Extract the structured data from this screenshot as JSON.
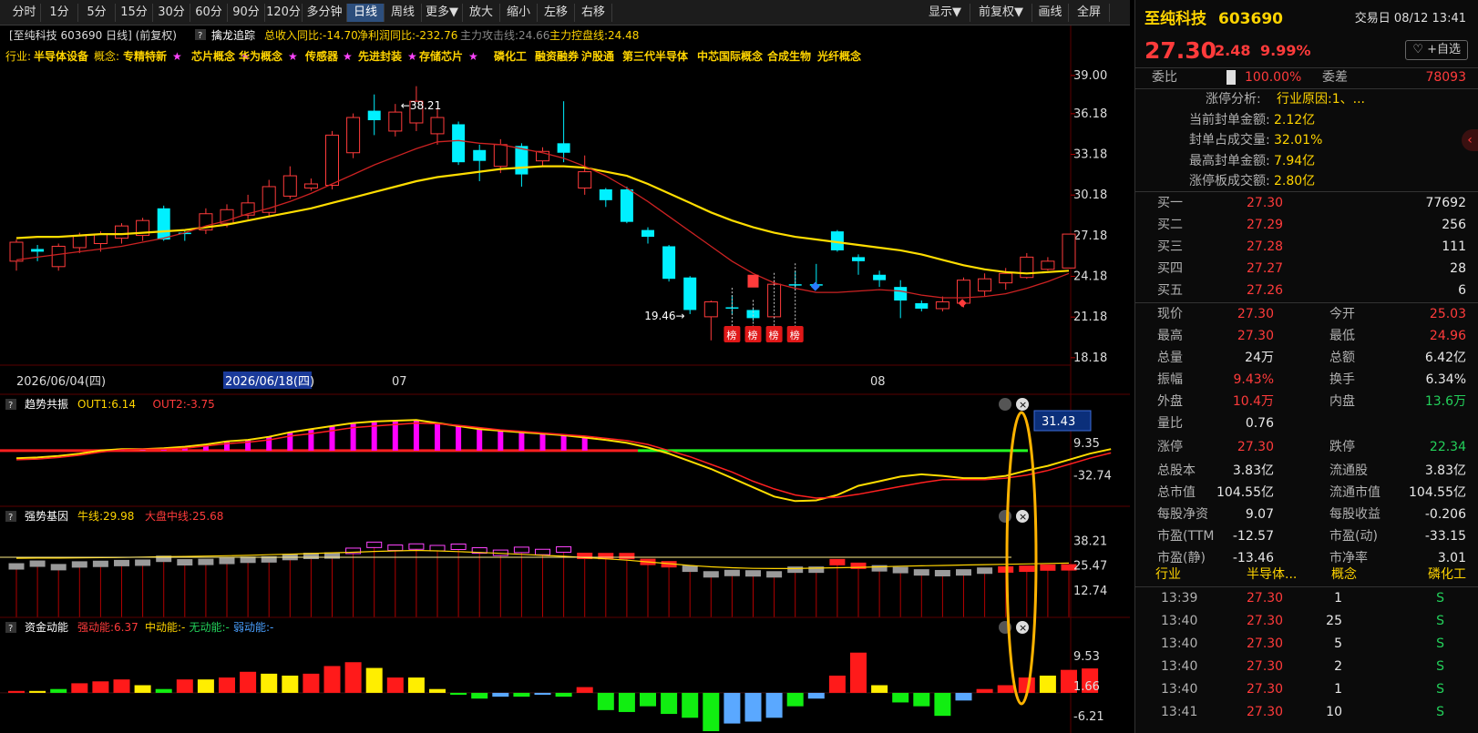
{
  "toolbar": {
    "buttons": [
      "分时",
      "1分",
      "5分",
      "15分",
      "30分",
      "60分",
      "90分",
      "120分",
      "多分钟",
      "日线",
      "周线",
      "更多▼",
      "放大",
      "缩小",
      "左移",
      "右移"
    ],
    "active_index": 9,
    "right_buttons": [
      "显示▼",
      "前复权▼",
      "画线",
      "全屏"
    ]
  },
  "chart_header": {
    "main": {
      "title": "[至纯科技 603690 日线] (前复权)",
      "indicator": "擒龙追踪",
      "rev": "总收入同比:-14.70",
      "profit": "净利润同比:-232.76",
      "attack": "主力攻击线:24.66",
      "control": "主力控盘线:24.48"
    },
    "industry_label": "行业:",
    "industry": "半导体设备",
    "concept_label": "概念:",
    "concepts": [
      "专精特新",
      "芯片概念",
      "华为概念",
      "传感器",
      "先进封装",
      "存储芯片",
      "磷化工",
      "融资融券",
      "沪股通",
      "第三代半导体",
      "中芯国际概念",
      "合成生物",
      "光纤概念"
    ],
    "concept_stars": [
      true,
      true,
      true,
      true,
      true,
      true,
      false,
      false,
      false,
      false,
      false,
      false,
      false
    ],
    "question_mark": "?"
  },
  "axis_dates": {
    "d1": "2026/06/04(四)",
    "d2": "2026/06/18(四)",
    "m1": "07",
    "m2": "08"
  },
  "chart_data": [
    {
      "type": "candlestick",
      "y_ticks": [
        39.0,
        36.18,
        33.18,
        30.18,
        27.18,
        24.18,
        21.18,
        18.18
      ],
      "y_tick_labels": [
        "39.00",
        "36.18",
        "33.18",
        "30.18",
        "27.18",
        "24.18",
        "21.18",
        "18.18"
      ],
      "ylim": [
        17.7,
        40.0
      ],
      "high_label": "38.21",
      "low_label": "19.46",
      "high_index": 18,
      "low_index": 32,
      "candles": [
        [
          25.3,
          26.7,
          24.6,
          26.9
        ],
        [
          26.2,
          26.0,
          25.3,
          26.5
        ],
        [
          24.9,
          26.4,
          24.6,
          26.6
        ],
        [
          26.3,
          27.2,
          25.9,
          27.4
        ],
        [
          26.6,
          27.3,
          26.0,
          27.5
        ],
        [
          27.0,
          27.9,
          26.6,
          28.1
        ],
        [
          27.2,
          28.3,
          26.8,
          28.5
        ],
        [
          29.2,
          26.9,
          26.8,
          29.4
        ],
        [
          27.4,
          27.3,
          26.8,
          27.6
        ],
        [
          27.6,
          28.8,
          27.3,
          29.2
        ],
        [
          28.1,
          29.1,
          27.8,
          29.5
        ],
        [
          28.7,
          29.6,
          28.4,
          30.2
        ],
        [
          28.9,
          30.8,
          28.6,
          31.3
        ],
        [
          30.1,
          31.6,
          29.9,
          32.3
        ],
        [
          30.7,
          31.0,
          30.5,
          31.4
        ],
        [
          30.9,
          34.6,
          30.6,
          34.9
        ],
        [
          33.3,
          35.9,
          32.9,
          36.2
        ],
        [
          36.4,
          35.7,
          34.6,
          37.6
        ],
        [
          34.9,
          36.3,
          34.5,
          36.9
        ],
        [
          35.5,
          37.1,
          34.9,
          38.21
        ],
        [
          34.7,
          35.9,
          33.9,
          36.6
        ],
        [
          35.4,
          32.6,
          32.4,
          35.6
        ],
        [
          33.5,
          32.7,
          31.2,
          33.9
        ],
        [
          32.3,
          33.9,
          31.8,
          34.3
        ],
        [
          33.8,
          31.7,
          30.8,
          34.0
        ],
        [
          32.7,
          33.4,
          32.3,
          33.7
        ],
        [
          34.0,
          33.3,
          32.6,
          37.1
        ],
        [
          30.7,
          31.9,
          30.2,
          33.1
        ],
        [
          30.6,
          29.8,
          29.3,
          30.7
        ],
        [
          30.6,
          28.2,
          28.1,
          30.8
        ],
        [
          27.6,
          27.1,
          26.6,
          27.8
        ],
        [
          26.4,
          24.0,
          23.8,
          26.5
        ],
        [
          24.1,
          21.7,
          21.4,
          24.2
        ],
        [
          21.2,
          22.3,
          19.46,
          22.4
        ],
        [
          21.9,
          21.8,
          21.4,
          22.8
        ],
        [
          21.7,
          21.1,
          20.9,
          21.9
        ],
        [
          21.2,
          23.6,
          21.1,
          23.9
        ],
        [
          23.6,
          23.5,
          23.2,
          24.6
        ],
        [
          23.6,
          23.5,
          23.4,
          25.1
        ],
        [
          27.5,
          26.1,
          26.0,
          27.6
        ],
        [
          25.6,
          25.3,
          24.3,
          25.8
        ],
        [
          24.3,
          23.9,
          23.4,
          24.6
        ],
        [
          23.4,
          22.4,
          21.1,
          23.9
        ],
        [
          22.2,
          21.8,
          21.6,
          22.4
        ],
        [
          21.8,
          22.3,
          21.6,
          22.7
        ],
        [
          22.2,
          23.9,
          21.9,
          24.1
        ],
        [
          23.1,
          24.0,
          22.7,
          24.4
        ],
        [
          23.7,
          24.4,
          23.2,
          24.8
        ],
        [
          24.1,
          25.6,
          24.0,
          25.9
        ],
        [
          24.7,
          25.3,
          24.6,
          25.6
        ],
        [
          24.8,
          27.3,
          24.8,
          27.3
        ]
      ],
      "ma_slow": [
        27.0,
        27.1,
        27.1,
        27.2,
        27.3,
        27.3,
        27.4,
        27.5,
        27.6,
        27.8,
        28.0,
        28.3,
        28.6,
        28.9,
        29.2,
        29.6,
        30.0,
        30.4,
        30.8,
        31.2,
        31.5,
        31.7,
        31.9,
        32.1,
        32.2,
        32.3,
        32.3,
        32.2,
        31.9,
        31.6,
        31.0,
        30.3,
        29.6,
        28.9,
        28.3,
        27.8,
        27.4,
        27.1,
        26.9,
        26.7,
        26.5,
        26.3,
        26.1,
        25.8,
        25.4,
        25.0,
        24.7,
        24.5,
        24.4,
        24.5,
        24.6
      ],
      "ma_fast": [
        25.4,
        25.6,
        25.8,
        26.0,
        26.2,
        26.4,
        26.7,
        27.0,
        27.4,
        27.9,
        28.3,
        28.8,
        29.2,
        29.7,
        30.3,
        31.0,
        31.7,
        32.4,
        33.0,
        33.6,
        34.1,
        34.2,
        34.0,
        33.9,
        33.6,
        33.3,
        32.9,
        32.3,
        31.6,
        30.7,
        29.7,
        28.6,
        27.5,
        26.4,
        25.3,
        24.4,
        23.7,
        23.3,
        23.0,
        23.0,
        23.1,
        23.2,
        23.1,
        22.8,
        22.6,
        22.6,
        22.7,
        22.9,
        23.3,
        23.8,
        24.4
      ],
      "bang_indexes": [
        34,
        35,
        36,
        37
      ],
      "bang_text": "榜"
    },
    {
      "type": "line",
      "title": "趋势共振",
      "legend": [
        {
          "name": "OUT1",
          "value": "6.14"
        },
        {
          "name": "OUT2",
          "value": "-3.75"
        }
      ],
      "y_tick_labels": [
        "9.35",
        "-32.74"
      ],
      "current_box": "31.43",
      "ylim": [
        -68,
        45
      ],
      "baseline": 0,
      "out1": [
        -10,
        -9,
        -7,
        -4,
        0,
        2,
        2,
        3,
        5,
        8,
        12,
        14,
        18,
        24,
        28,
        32,
        36,
        38,
        39,
        40,
        36,
        32,
        28,
        26,
        24,
        22,
        20,
        17,
        14,
        10,
        4,
        -4,
        -14,
        -24,
        -36,
        -48,
        -60,
        -66,
        -65,
        -58,
        -46,
        -40,
        -34,
        -31,
        -33,
        -36,
        -36,
        -33,
        -26,
        -20,
        -12,
        -4,
        2
      ],
      "out2": [
        -12,
        -11,
        -9,
        -6,
        -2,
        1,
        2,
        2,
        3,
        6,
        9,
        11,
        14,
        19,
        22,
        26,
        30,
        32,
        34,
        36,
        35,
        33,
        30,
        27,
        25,
        23,
        21,
        19,
        16,
        13,
        8,
        0,
        -8,
        -18,
        -28,
        -40,
        -50,
        -58,
        -62,
        -61,
        -57,
        -52,
        -47,
        -42,
        -38,
        -38,
        -38,
        -36,
        -32,
        -26,
        -18,
        -10,
        -3
      ]
    },
    {
      "type": "bar",
      "title": "强势基因",
      "legend": [
        {
          "name": "牛线",
          "value": "29.98"
        },
        {
          "name": "大盘中线",
          "value": "25.68"
        }
      ],
      "y_tick_labels": [
        "38.21",
        "25.47",
        "12.74"
      ],
      "ylim": [
        0,
        45
      ],
      "bull_line": [
        29.5,
        29.6,
        29.6,
        29.7,
        29.8,
        29.9,
        30.1,
        30.3,
        30.4,
        30.6,
        30.8,
        31.0,
        31.3,
        31.6,
        31.9,
        32.3,
        32.6,
        33.0,
        33.3,
        33.5,
        33.3,
        32.9,
        32.5,
        32.0,
        31.5,
        31.0,
        30.5,
        29.8,
        29.2,
        28.5,
        27.6,
        26.7,
        25.8,
        25.1,
        24.6,
        24.3,
        24.2,
        24.2,
        24.4,
        24.6,
        24.8,
        25.1,
        25.4,
        25.6,
        25.8,
        26.0,
        26.2,
        26.4,
        26.6,
        26.8,
        27.0
      ],
      "market_line": 29.98,
      "bar_values": [
        25.3,
        26.7,
        24.9,
        26.3,
        26.6,
        27.0,
        27.2,
        29.2,
        27.4,
        27.6,
        28.1,
        28.7,
        28.9,
        30.1,
        30.7,
        30.9,
        33.3,
        36.4,
        34.9,
        35.5,
        34.7,
        35.4,
        33.5,
        32.3,
        33.8,
        32.7,
        34.0,
        30.7,
        30.6,
        30.6,
        27.6,
        26.4,
        24.1,
        21.2,
        21.9,
        21.7,
        21.2,
        23.6,
        23.6,
        27.5,
        25.6,
        24.3,
        23.4,
        22.2,
        21.8,
        22.2,
        23.1,
        23.7,
        24.1,
        24.7,
        24.8
      ]
    },
    {
      "type": "bar",
      "title": "资金动能",
      "legend": [
        {
          "name": "强动能",
          "value": "6.37"
        },
        {
          "name": "中动能",
          "value": "-"
        },
        {
          "name": "无动能",
          "value": "-"
        },
        {
          "name": "弱动能",
          "value": "-"
        }
      ],
      "y_tick_labels": [
        "9.53",
        "1.66",
        "-6.21"
      ],
      "ylim": [
        -10,
        14
      ],
      "values": [
        0.5,
        0.5,
        1.0,
        2.5,
        3.0,
        3.5,
        2.0,
        1.0,
        3.5,
        3.5,
        4.0,
        5.5,
        5.0,
        4.5,
        5.0,
        7.0,
        8.0,
        6.5,
        4.0,
        4.0,
        1.0,
        -0.5,
        -1.5,
        -1.0,
        -1.0,
        -0.5,
        -1.0,
        1.5,
        -4.5,
        -5.0,
        -3.5,
        -5.5,
        -6.5,
        -10.0,
        -8.0,
        -7.5,
        -6.5,
        -3.5,
        -1.5,
        4.5,
        10.5,
        2.0,
        -2.5,
        -3.5,
        -6.0,
        -2.0,
        1.0,
        2.0,
        4.0,
        4.5,
        6.0,
        6.37
      ],
      "colors": [
        "red",
        "yellow",
        "green",
        "red",
        "red",
        "red",
        "yellow",
        "green",
        "red",
        "yellow",
        "red",
        "red",
        "yellow",
        "yellow",
        "red",
        "red",
        "red",
        "yellow",
        "red",
        "yellow",
        "yellow",
        "green",
        "green",
        "blue",
        "green",
        "blue",
        "green",
        "red",
        "green",
        "green",
        "green",
        "green",
        "green",
        "green",
        "blue",
        "blue",
        "blue",
        "green",
        "blue",
        "red",
        "red",
        "yellow",
        "green",
        "green",
        "green",
        "blue",
        "red",
        "red",
        "red",
        "yellow",
        "red",
        "red"
      ]
    }
  ],
  "colors": {
    "up": "#ff3b3b",
    "down": "#00f0ff",
    "ma_slow": "#ffdd00",
    "ma_fast": "#cc2222",
    "magenta": "#ff00ff",
    "lime": "#22ff22",
    "orange": "#ffb300",
    "grid": "#5a0000"
  },
  "panel": {
    "name": "至纯科技",
    "code": "603690",
    "trade_day": "交易日 08/12 13:41",
    "price": "27.30",
    "change": "2.48",
    "change_pct": "9.99%",
    "favorite": "♡ +自选",
    "weibi_label": "委比",
    "weibi": "100.00%",
    "weicha_label": "委差",
    "weicha": "78093",
    "limit_analysis": [
      {
        "label": "涨停分析:",
        "value": "行业原因:1、..."
      },
      {
        "label": "当前封单金额:",
        "value": "2.12亿"
      },
      {
        "label": "封单占成交量:",
        "value": "32.01%"
      },
      {
        "label": "最高封单金额:",
        "value": "7.94亿"
      },
      {
        "label": "涨停板成交额:",
        "value": "2.80亿"
      }
    ],
    "bids": [
      {
        "label": "买一",
        "price": "27.30",
        "vol": "77692"
      },
      {
        "label": "买二",
        "price": "27.29",
        "vol": "256"
      },
      {
        "label": "买三",
        "price": "27.28",
        "vol": "111"
      },
      {
        "label": "买四",
        "price": "27.27",
        "vol": "28"
      },
      {
        "label": "买五",
        "price": "27.26",
        "vol": "6"
      }
    ],
    "quote": [
      {
        "l1": "现价",
        "v1": "27.30",
        "c1": "red",
        "l2": "今开",
        "v2": "25.03",
        "c2": "red"
      },
      {
        "l1": "最高",
        "v1": "27.30",
        "c1": "red",
        "l2": "最低",
        "v2": "24.96",
        "c2": "red"
      },
      {
        "l1": "总量",
        "v1": "24万",
        "c1": "wht",
        "l2": "总额",
        "v2": "6.42亿",
        "c2": "wht"
      },
      {
        "l1": "振幅",
        "v1": "9.43%",
        "c1": "red",
        "l2": "换手",
        "v2": "6.34%",
        "c2": "wht"
      },
      {
        "l1": "外盘",
        "v1": "10.4万",
        "c1": "red",
        "l2": "内盘",
        "v2": "13.6万",
        "c2": "grn"
      },
      {
        "l1": "量比",
        "v1": "0.76",
        "c1": "wht",
        "l2": "",
        "v2": "",
        "c2": "wht"
      },
      {
        "l1": "涨停",
        "v1": "27.30",
        "c1": "red",
        "l2": "跌停",
        "v2": "22.34",
        "c2": "grn"
      },
      {
        "l1": "总股本",
        "v1": "3.83亿",
        "c1": "wht",
        "l2": "流通股",
        "v2": "3.83亿",
        "c2": "wht"
      },
      {
        "l1": "总市值",
        "v1": "104.55亿",
        "c1": "wht",
        "l2": "流通市值",
        "v2": "104.55亿",
        "c2": "wht"
      },
      {
        "l1": "每股净资",
        "v1": "9.07",
        "c1": "wht",
        "l2": "每股收益",
        "v2": "-0.206",
        "c2": "wht"
      },
      {
        "l1": "市盈(TTM",
        "v1": "-12.57",
        "c1": "wht",
        "l2": "市盈(动)",
        "v2": "-33.15",
        "c2": "wht"
      },
      {
        "l1": "市盈(静)",
        "v1": "-13.46",
        "c1": "wht",
        "l2": "市净率",
        "v2": "3.01",
        "c2": "wht"
      }
    ],
    "sector": {
      "l1": "行业",
      "v1": "半导体...",
      "l2": "概念",
      "v2": "磷化工"
    },
    "ticks": [
      {
        "time": "13:39",
        "price": "27.30",
        "vol": "1",
        "flag": "S"
      },
      {
        "time": "13:40",
        "price": "27.30",
        "vol": "25",
        "flag": "S"
      },
      {
        "time": "13:40",
        "price": "27.30",
        "vol": "5",
        "flag": "S"
      },
      {
        "time": "13:40",
        "price": "27.30",
        "vol": "2",
        "flag": "S"
      },
      {
        "time": "13:40",
        "price": "27.30",
        "vol": "1",
        "flag": "S"
      },
      {
        "time": "13:41",
        "price": "27.30",
        "vol": "10",
        "flag": "S"
      }
    ]
  }
}
